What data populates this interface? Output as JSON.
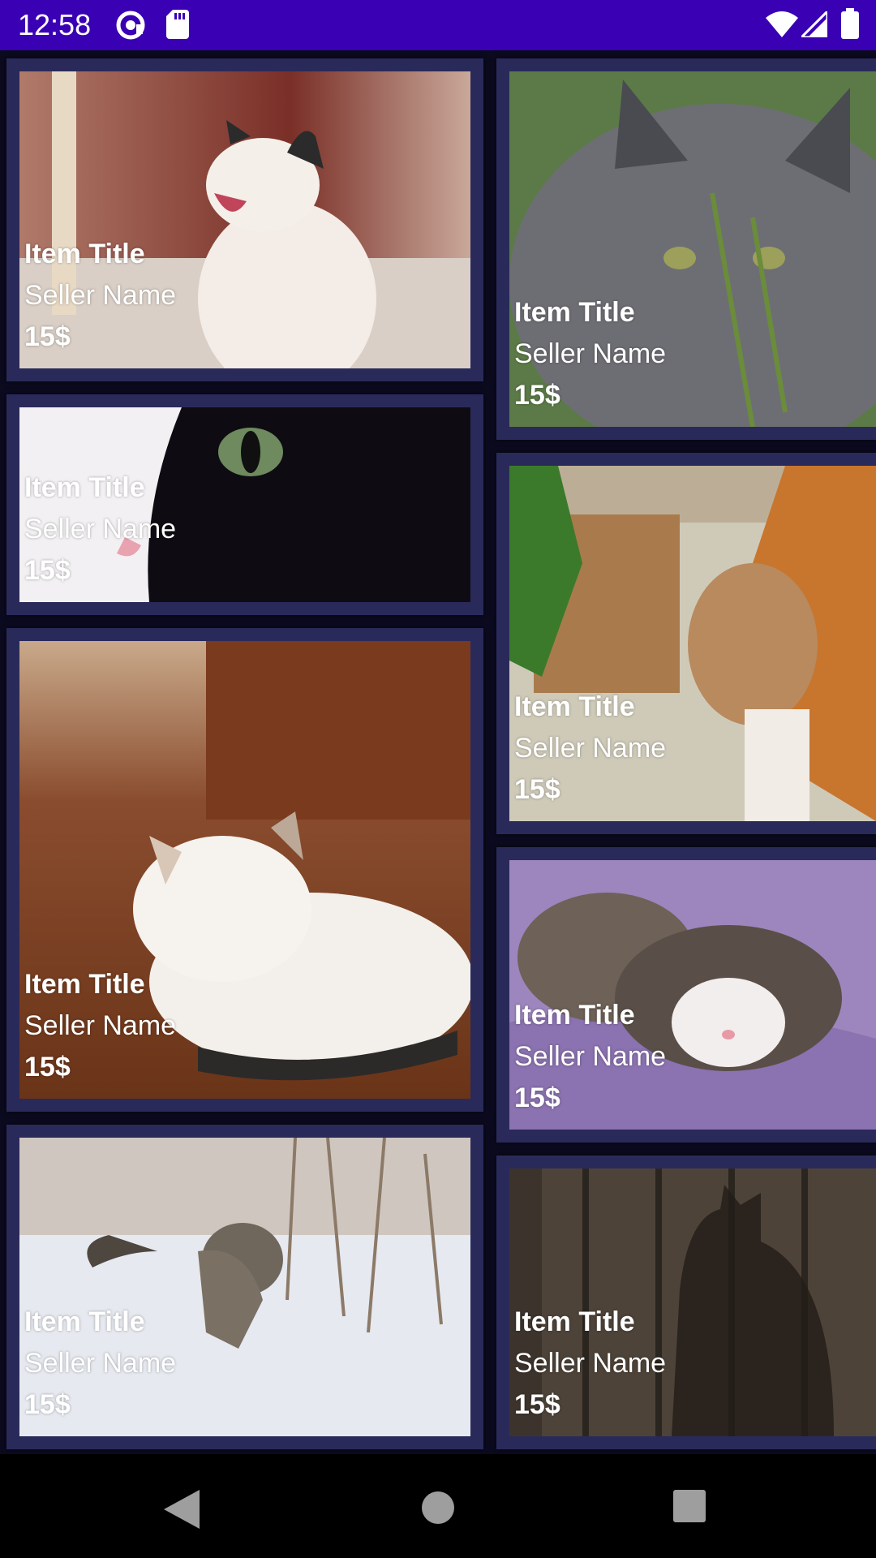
{
  "status_bar": {
    "time": "12:58",
    "left_icons": [
      "at-sign-icon",
      "sd-card-icon"
    ],
    "right_icons": [
      "wifi-icon",
      "cell-signal-icon",
      "battery-icon"
    ]
  },
  "colors": {
    "status_bar": "#3a00b4",
    "card_frame": "#2a2a5a",
    "background": "#0b0a1f",
    "nav_bar": "#000000"
  },
  "items": [
    {
      "title": "Item Title",
      "seller": "Seller Name",
      "price": "15$",
      "image": "yawning-white-cat-photo"
    },
    {
      "title": "Item Title",
      "seller": "Seller Name",
      "price": "15$",
      "image": "black-white-cat-closeup-photo"
    },
    {
      "title": "Item Title",
      "seller": "Seller Name",
      "price": "15$",
      "image": "white-tabby-cat-resting-photo"
    },
    {
      "title": "Item Title",
      "seller": "Seller Name",
      "price": "15$",
      "image": "tabby-cat-in-snow-photo"
    },
    {
      "title": "Item Title",
      "seller": "Seller Name",
      "price": "15$",
      "image": "gray-longhair-cat-photo"
    },
    {
      "title": "Item Title",
      "seller": "Seller Name",
      "price": "15$",
      "image": "orange-white-cat-photo"
    },
    {
      "title": "Item Title",
      "seller": "Seller Name",
      "price": "15$",
      "image": "sleeping-kittens-photo"
    },
    {
      "title": "Item Title",
      "seller": "Seller Name",
      "price": "15$",
      "image": "cat-shadow-on-wood-photo"
    }
  ],
  "nav_bar": {
    "buttons": [
      "back-icon",
      "home-icon",
      "recents-icon"
    ]
  }
}
